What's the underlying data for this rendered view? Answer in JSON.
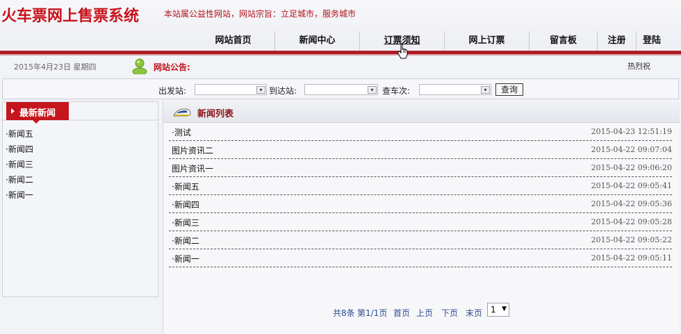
{
  "header": {
    "logo": "火车票网上售票系统",
    "slogan": "本站属公益性网站，网站宗旨：立足城市，服务城市"
  },
  "nav": {
    "items": [
      {
        "label": "网站首页"
      },
      {
        "label": "新闻中心"
      },
      {
        "label": "订票须知"
      },
      {
        "label": "网上订票"
      },
      {
        "label": "留言板"
      },
      {
        "label": "注册"
      },
      {
        "label": "登陆"
      }
    ],
    "active": "订票须知"
  },
  "infobar": {
    "date": "2015年4月23日 星期四",
    "notice_label": "网站公告:",
    "hotline": "热烈祝"
  },
  "search": {
    "from_label": "出发站:",
    "to_label": "到达站:",
    "train_label": "查车次:",
    "button": "查询"
  },
  "sidebar": {
    "title": "最新新闻",
    "items": [
      {
        "label": "·新闻五"
      },
      {
        "label": "·新闻四"
      },
      {
        "label": "·新闻三"
      },
      {
        "label": "·新闻二"
      },
      {
        "label": "·新闻一"
      }
    ]
  },
  "main": {
    "title": "新闻列表",
    "news": [
      {
        "title": "·测试",
        "date": "2015-04-23 12:51:19"
      },
      {
        "title": "图片资讯二",
        "date": "2015-04-22 09:07:04"
      },
      {
        "title": "图片资讯一",
        "date": "2015-04-22 09:06:20"
      },
      {
        "title": "·新闻五",
        "date": "2015-04-22 09:05:41"
      },
      {
        "title": "·新闻四",
        "date": "2015-04-22 09:05:36"
      },
      {
        "title": "·新闻三",
        "date": "2015-04-22 09:05:28"
      },
      {
        "title": "·新闻二",
        "date": "2015-04-22 09:05:22"
      },
      {
        "title": "·新闻一",
        "date": "2015-04-22 09:05:11"
      }
    ]
  },
  "pager": {
    "total": "共8条",
    "page_info": "第1/1页",
    "first": "首页",
    "prev": "上页",
    "next": "下页",
    "last": "末页",
    "current": "1"
  },
  "icons": {
    "notice": "user-icon",
    "news_list": "train-icon",
    "cursor": "hand-cursor-icon"
  },
  "colors": {
    "brand_red": "#c8121a",
    "nav_bar": "#b01c24",
    "link_blue": "#2b4d8f"
  }
}
